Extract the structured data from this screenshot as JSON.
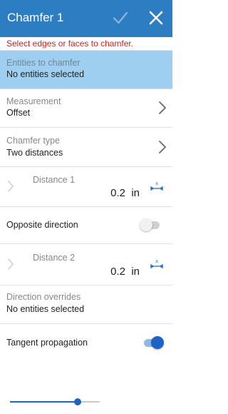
{
  "header": {
    "title": "Chamfer 1",
    "background": "#2c7dc1",
    "confirm_icon": "checkmark-icon",
    "close_icon": "close-icon"
  },
  "hint": {
    "text": "Select edges or faces to chamfer.",
    "color": "#c2262f"
  },
  "entities": {
    "label": "Entities to chamfer",
    "value": "No entities selected",
    "highlight": "#9fcff0"
  },
  "measurement": {
    "label": "Measurement",
    "value": "Offset"
  },
  "chamfer_type": {
    "label": "Chamfer type",
    "value": "Two distances"
  },
  "distance1": {
    "label": "Distance 1",
    "value": "0.2",
    "unit": "in"
  },
  "opposite_direction": {
    "label": "Opposite direction",
    "enabled": false
  },
  "distance2": {
    "label": "Distance 2",
    "value": "0.2",
    "unit": "in"
  },
  "direction_overrides": {
    "label": "Direction overrides",
    "value": "No entities selected"
  },
  "tangent_propagation": {
    "label": "Tangent propagation",
    "enabled": true
  },
  "slider": {
    "level": 0.75,
    "accent": "#1e63c4"
  }
}
